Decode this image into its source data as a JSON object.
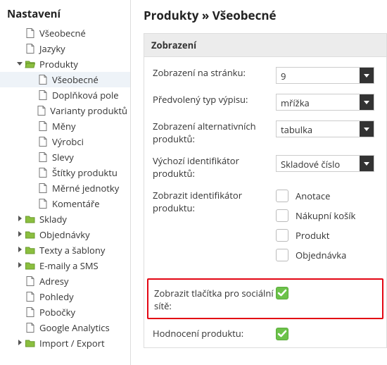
{
  "sidebar": {
    "title": "Nastavení",
    "items": [
      {
        "label": "Všeobecné",
        "type": "file",
        "depth": 1
      },
      {
        "label": "Jazyky",
        "type": "file",
        "depth": 1
      },
      {
        "label": "Produkty",
        "type": "folder-open",
        "depth": 1,
        "caret": "down"
      },
      {
        "label": "Všeobecné",
        "type": "file",
        "depth": 2,
        "selected": true
      },
      {
        "label": "Doplňková pole",
        "type": "file",
        "depth": 2
      },
      {
        "label": "Varianty produktů",
        "type": "file",
        "depth": 2
      },
      {
        "label": "Měny",
        "type": "file",
        "depth": 2
      },
      {
        "label": "Výrobci",
        "type": "file",
        "depth": 2
      },
      {
        "label": "Slevy",
        "type": "file",
        "depth": 2
      },
      {
        "label": "Štítky produktu",
        "type": "file",
        "depth": 2
      },
      {
        "label": "Měrné jednotky",
        "type": "file",
        "depth": 2
      },
      {
        "label": "Komentáře",
        "type": "file",
        "depth": 2
      },
      {
        "label": "Sklady",
        "type": "folder",
        "depth": 1,
        "caret": "right"
      },
      {
        "label": "Objednávky",
        "type": "folder",
        "depth": 1,
        "caret": "right"
      },
      {
        "label": "Texty a šablony",
        "type": "folder",
        "depth": 1,
        "caret": "right"
      },
      {
        "label": "E-maily a SMS",
        "type": "folder",
        "depth": 1,
        "caret": "right"
      },
      {
        "label": "Adresy",
        "type": "file",
        "depth": 1
      },
      {
        "label": "Pohledy",
        "type": "file",
        "depth": 1
      },
      {
        "label": "Pobočky",
        "type": "file",
        "depth": 1
      },
      {
        "label": "Google Analytics",
        "type": "file",
        "depth": 1
      },
      {
        "label": "Import / Export",
        "type": "folder",
        "depth": 1,
        "caret": "right"
      }
    ]
  },
  "main": {
    "title": "Produkty » Všeobecné",
    "panel_title": "Zobrazení",
    "rows": {
      "per_page": {
        "label": "Zobrazení na stránku:",
        "value": "9"
      },
      "list_type": {
        "label": "Předvolený typ výpisu:",
        "value": "mřížka"
      },
      "alt_products": {
        "label": "Zobrazení alternativních produktů:",
        "value": "tabulka"
      },
      "default_id": {
        "label": "Výchozí identifikátor produktů:",
        "value": "Skladové číslo"
      },
      "show_id": {
        "label": "Zobrazit identifikátor produktu:",
        "options": [
          "Anotace",
          "Nákupní košík",
          "Produkt",
          "Objednávka"
        ]
      },
      "social": {
        "label": "Zobrazit tlačítka pro sociální sítě:",
        "checked": true
      },
      "rating": {
        "label": "Hodnocení produktu:",
        "checked": true
      }
    }
  }
}
